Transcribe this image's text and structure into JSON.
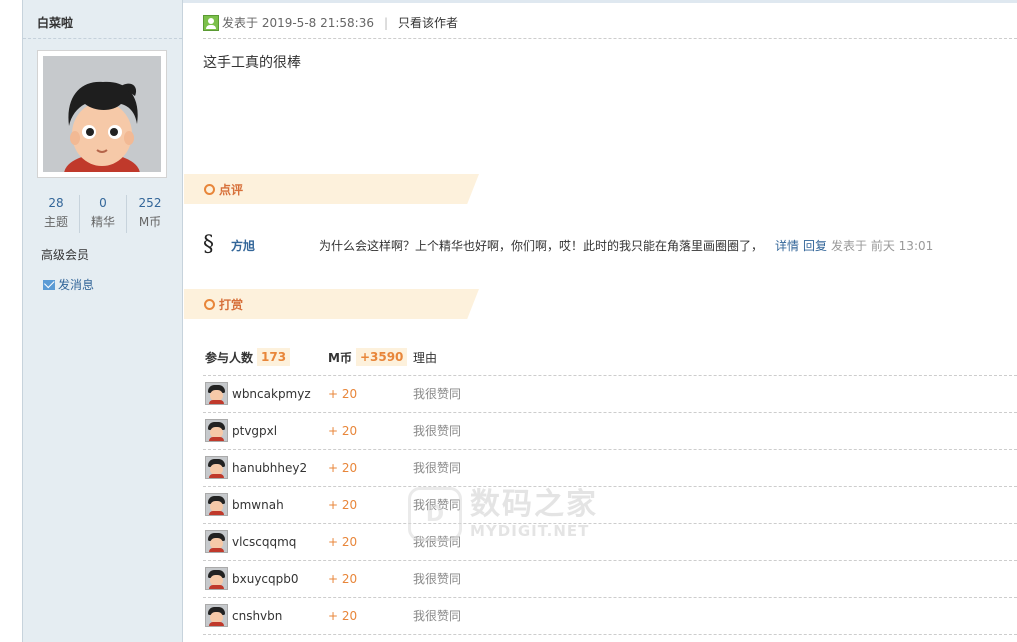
{
  "author": {
    "name": "白菜啦",
    "stats": [
      {
        "num": "28",
        "label": "主题"
      },
      {
        "num": "0",
        "label": "精华"
      },
      {
        "num": "252",
        "label": "M币"
      }
    ],
    "rank": "高级会员",
    "send_message": "发消息"
  },
  "post": {
    "posted_at": "发表于 2019-5-8 21:58:36",
    "only_author": "只看该作者",
    "body": "这手工真的很棒"
  },
  "comment_section": {
    "title": "点评",
    "items": [
      {
        "user": "方旭",
        "text": "为什么会这样啊？上个精华也好啊，你们啊，哎！此时的我只能在角落里画圈圈了，",
        "detail": "详情",
        "reply": "回复",
        "time": "发表于 前天 13:01"
      }
    ]
  },
  "reward_section": {
    "title": "打赏",
    "participants_label": "参与人数",
    "participants_count": "173",
    "currency_label": "M币",
    "currency_total": "+3590",
    "reason_label": "理由",
    "rows": [
      {
        "user": "wbncakpmyz",
        "amount": "+ 20",
        "reason": "我很赞同"
      },
      {
        "user": "ptvgpxl",
        "amount": "+ 20",
        "reason": "我很赞同"
      },
      {
        "user": "hanubhhey2",
        "amount": "+ 20",
        "reason": "我很赞同"
      },
      {
        "user": "bmwnah",
        "amount": "+ 20",
        "reason": "我很赞同"
      },
      {
        "user": "vlcscqqmq",
        "amount": "+ 20",
        "reason": "我很赞同"
      },
      {
        "user": "bxuycqpb0",
        "amount": "+ 20",
        "reason": "我很赞同"
      },
      {
        "user": "cnshvbn",
        "amount": "+ 20",
        "reason": "我很赞同"
      }
    ]
  },
  "watermark": {
    "logo_text": "D",
    "cn": "数码之家",
    "en": "MYDIGIT.NET"
  },
  "colors": {
    "sidebar_bg": "#e5edf2",
    "link_blue": "#336699",
    "accent_orange": "#e8863a",
    "section_bg": "#fdf1dc"
  }
}
